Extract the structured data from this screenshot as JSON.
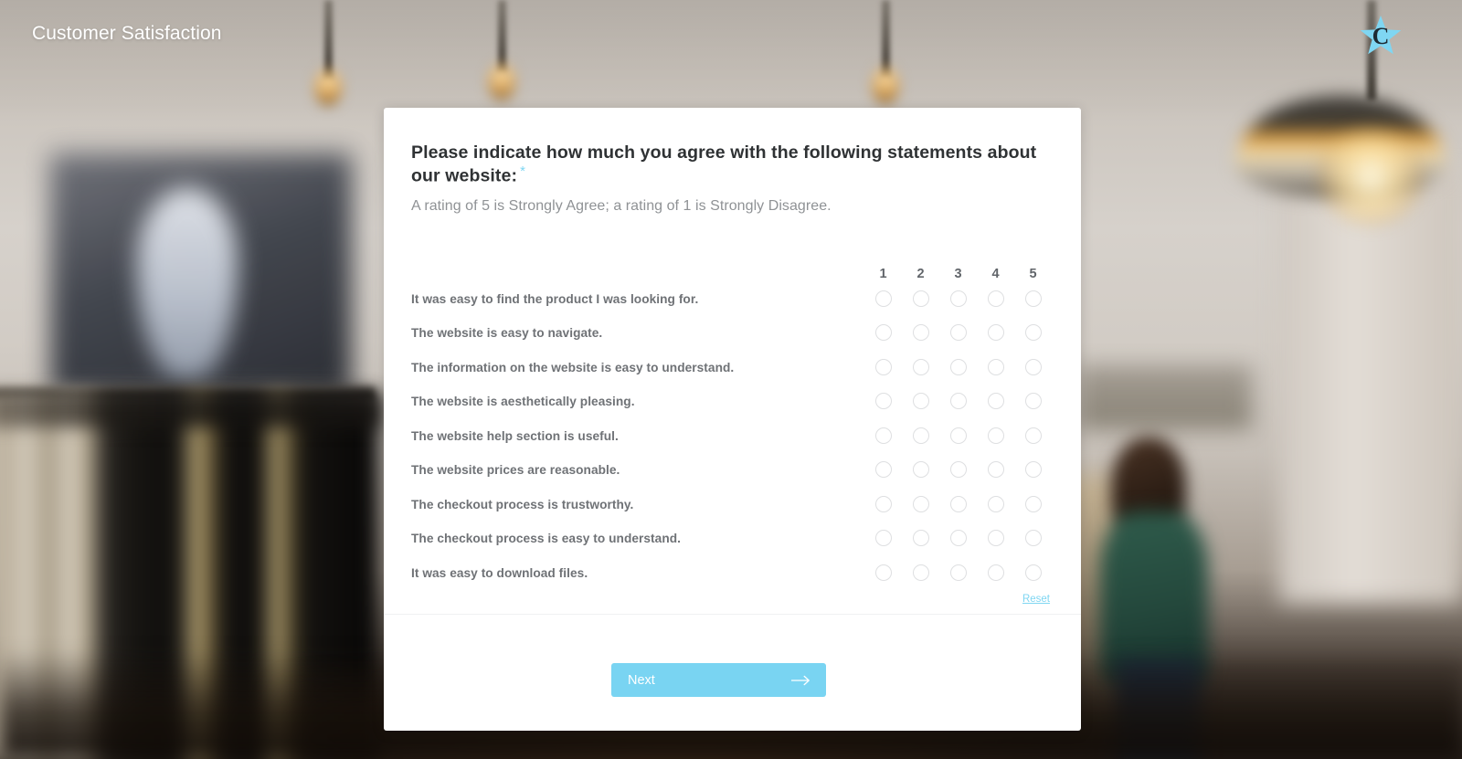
{
  "header": {
    "title": "Customer Satisfaction",
    "logo_name": "star-c-logo",
    "logo_color": "#7fd6f2"
  },
  "question": {
    "title": "Please indicate how much you agree with the following statements about our website:",
    "required_marker": "*",
    "subtitle": "A rating of 5 is Strongly Agree; a rating of 1 is Strongly Disagree."
  },
  "matrix": {
    "scale_headers": [
      "1",
      "2",
      "3",
      "4",
      "5"
    ],
    "statements": [
      "It was easy to find the product I was looking for.",
      "The website is easy to navigate.",
      "The information on the website is easy to understand.",
      "The website is aesthetically pleasing.",
      "The website help section is useful.",
      "The website prices are reasonable.",
      "The checkout process is trustworthy.",
      "The checkout process is easy to understand.",
      "It was easy to download files."
    ],
    "selected": [
      null,
      null,
      null,
      null,
      null,
      null,
      null,
      null,
      null
    ],
    "reset_label": "Reset"
  },
  "footer": {
    "next_label": "Next",
    "next_icon": "arrow-right-icon",
    "next_color": "#79d4f2"
  },
  "accent_color": "#7fd6f2"
}
